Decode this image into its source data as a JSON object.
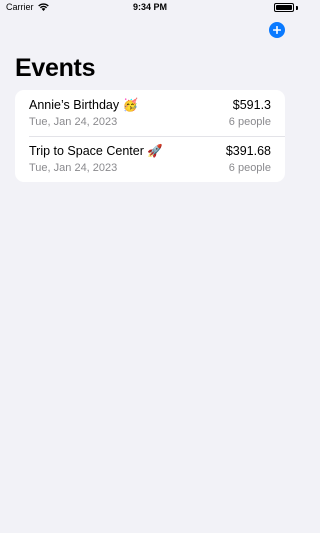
{
  "status_bar": {
    "carrier": "Carrier",
    "time": "9:34 PM",
    "battery_level": 1.0
  },
  "toolbar": {
    "add_icon": "plus-circle-icon",
    "accent_color": "#0a7aff"
  },
  "page": {
    "title": "Events"
  },
  "events": [
    {
      "name": "Annie’s Birthday 🥳",
      "date": "Tue, Jan 24, 2023",
      "amount": "$591.3",
      "people": "6 people"
    },
    {
      "name": "Trip to Space Center 🚀",
      "date": "Tue, Jan 24, 2023",
      "amount": "$391.68",
      "people": "6 people"
    }
  ]
}
